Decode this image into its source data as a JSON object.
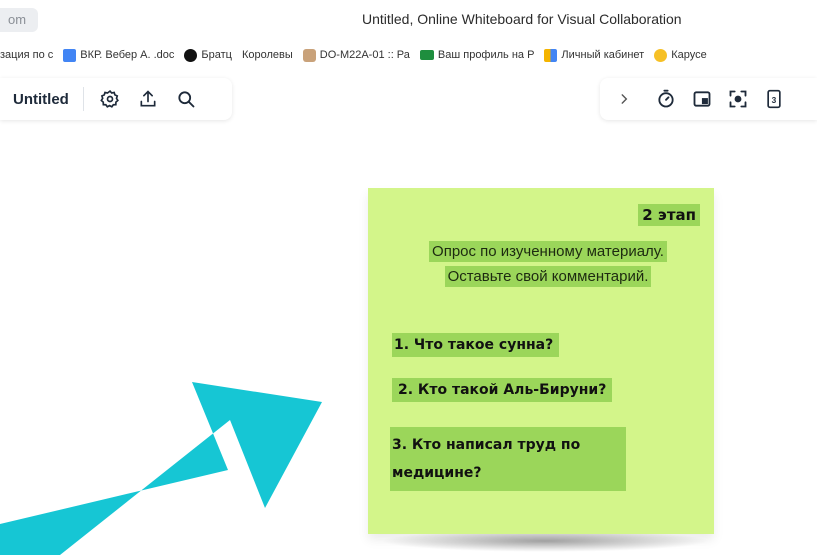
{
  "browser": {
    "url_fragment": "om",
    "window_title": "Untitled, Online Whiteboard for Visual Collaboration",
    "bookmarks": [
      {
        "label": "зация по с",
        "icon": "none"
      },
      {
        "label": "ВКР. Вебер А. .doc",
        "icon": "doc-icon"
      },
      {
        "label": "Братц",
        "icon": "circle-icon"
      },
      {
        "label": "Королевы",
        "icon": "none"
      },
      {
        "label": "DO-M22A-01 :: Ра",
        "icon": "folder-icon"
      },
      {
        "label": "Ваш профиль на Р",
        "icon": "bars-icon"
      },
      {
        "label": "Личный кабинет",
        "icon": "tiles-icon"
      },
      {
        "label": "Карусе",
        "icon": "gold-icon"
      }
    ]
  },
  "toolbar": {
    "board_title": "Untitled",
    "left_icons": [
      "settings-icon",
      "export-icon",
      "search-icon"
    ],
    "right_icons": [
      "chevron-right-icon",
      "timer-icon",
      "add-frame-icon",
      "focus-icon",
      "page-count-icon"
    ],
    "page_count": "3"
  },
  "sticky_note": {
    "color": "#d3f58a",
    "highlight_color": "#9bd65a",
    "stage": "2 этап",
    "survey_line1": "Опрос по изученному материалу.",
    "survey_line2": "Оставьте свой комментарий.",
    "questions": [
      "1. Что такое сунна?",
      "2.  Кто такой Аль-Бируни?",
      "3. Кто написал труд по медицине?"
    ]
  },
  "arrow": {
    "color": "#16c6d4"
  }
}
